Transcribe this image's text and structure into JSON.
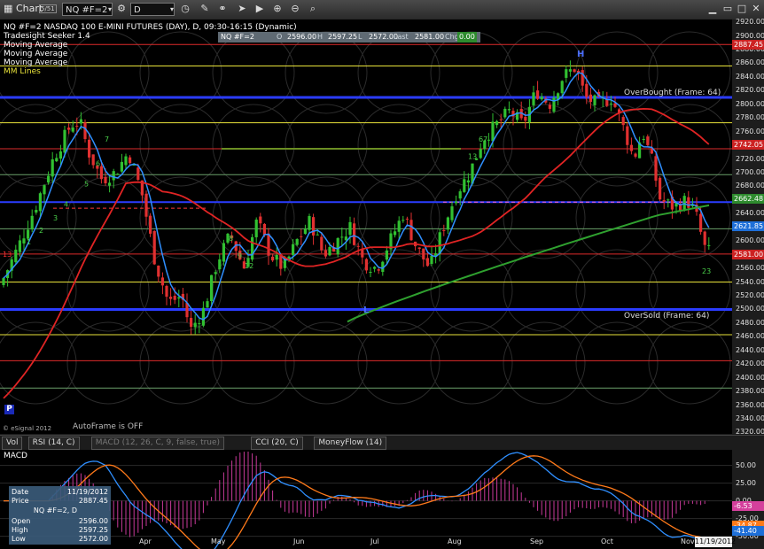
{
  "window": {
    "title": "Chart",
    "badge": "5/51"
  },
  "toolbar": {
    "symbol": "NQ #F=2",
    "interval": "D"
  },
  "legend": {
    "title": "NQ #F=2 NASDAQ 100 E-MINI FUTURES (DAY), D, 09:30-16:15 (Dynamic)",
    "lines": [
      "Tradesight Seeker 1.4",
      "Moving Average",
      "Moving Average",
      "Moving Average",
      "MM Lines"
    ]
  },
  "quote": {
    "symbol": "NQ #F=2",
    "o_label": "O",
    "open": "2596.00",
    "h_label": "H",
    "high": "2597.25",
    "l_label": "L",
    "low": "2572.00",
    "last_label": "Last",
    "last": "2581.00",
    "chg_label": "Chg",
    "chg": "0.00"
  },
  "annotations": {
    "overbought": "OverBought (Frame: 64)",
    "oversold": "OverSold (Frame: 64)",
    "autoframe": "AutoFrame is OFF",
    "copyright": "© eSignal 2012",
    "h_mark": "H",
    "l_mark": "L",
    "p_mark": "P",
    "count_13": "13",
    "count_23": "23"
  },
  "seeker_counts": [
    "1",
    "2",
    "3",
    "4",
    "5",
    "6",
    "7",
    "8",
    "9",
    "12",
    "13",
    "67",
    "45",
    "345"
  ],
  "price_axis": {
    "ticks": [
      "2920.00",
      "2900.00",
      "2880.00",
      "2860.00",
      "2840.00",
      "2820.00",
      "2800.00",
      "2780.00",
      "2760.00",
      "2740.00",
      "2720.00",
      "2700.00",
      "2680.00",
      "2660.00",
      "2640.00",
      "2620.00",
      "2600.00",
      "2580.00",
      "2560.00",
      "2540.00",
      "2520.00",
      "2500.00",
      "2480.00",
      "2460.00",
      "2440.00",
      "2420.00",
      "2400.00",
      "2380.00",
      "2360.00",
      "2340.00",
      "2320.00"
    ],
    "range": [
      2318,
      2924
    ]
  },
  "price_tags": [
    {
      "value": "2887.45",
      "color": "#cc2222",
      "text_color": "#ffffff"
    },
    {
      "value": "2742.05",
      "color": "#cc2222",
      "text_color": "#ffffff"
    },
    {
      "value": "2662.48",
      "color": "#2e8b2e",
      "text_color": "#ffffff"
    },
    {
      "value": "2621.85",
      "color": "#1e6fd8",
      "text_color": "#ffffff"
    },
    {
      "value": "2581.00",
      "color": "#cc2222",
      "text_color": "#ffffff"
    }
  ],
  "months": [
    "Apr",
    "May",
    "Jun",
    "Jul",
    "Aug",
    "Sep",
    "Oct",
    "Nov"
  ],
  "date_box": "11/19/2012",
  "tabs": [
    {
      "label": "Vol",
      "dim": false
    },
    {
      "label": "RSI (14, C)",
      "dim": false
    },
    {
      "label": "MACD (12, 26, C, 9, false, true)",
      "dim": true
    },
    {
      "label": "CCI (20, C)",
      "dim": false
    },
    {
      "label": "MoneyFlow (14)",
      "dim": false
    }
  ],
  "macd": {
    "label": "MACD",
    "ticks": [
      "50.00",
      "25.00",
      "0.00",
      "-25.00",
      "-50.00"
    ],
    "tags": [
      {
        "value": "-6.53",
        "color": "#d4409c"
      },
      {
        "value": "-34.87",
        "color": "#ff7a1a"
      },
      {
        "value": "-41.40",
        "color": "#1e6fd8"
      }
    ]
  },
  "info_window": {
    "rows": [
      {
        "label": "Date",
        "value": "11/19/2012"
      },
      {
        "label": "Price",
        "value": "2887.45"
      },
      {
        "label": "",
        "value": "NQ #F=2, D"
      },
      {
        "label": "Open",
        "value": "2596.00"
      },
      {
        "label": "High",
        "value": "2597.25"
      },
      {
        "label": "Low",
        "value": "2572.00"
      }
    ]
  },
  "mm_levels": [
    {
      "price": 2887.45,
      "color": "#dd2b2b"
    },
    {
      "price": 2856.0,
      "color": "#e8e23a"
    },
    {
      "price": 2810.0,
      "color": "#2b3cff",
      "width": 3
    },
    {
      "price": 2773.0,
      "color": "#e8e23a"
    },
    {
      "price": 2735.0,
      "color": "#dd2b2b"
    },
    {
      "price": 2697.0,
      "color": "#6aa06a"
    },
    {
      "price": 2657.0,
      "color": "#2b3cff",
      "width": 2
    },
    {
      "price": 2618.0,
      "color": "#6aa06a"
    },
    {
      "price": 2581.0,
      "color": "#dd2b2b"
    },
    {
      "price": 2540.0,
      "color": "#e8e23a"
    },
    {
      "price": 2500.0,
      "color": "#2b3cff",
      "width": 3
    },
    {
      "price": 2463.0,
      "color": "#e8e23a"
    },
    {
      "price": 2425.0,
      "color": "#dd2b2b"
    },
    {
      "price": 2385.0,
      "color": "#6aa06a"
    }
  ]
}
